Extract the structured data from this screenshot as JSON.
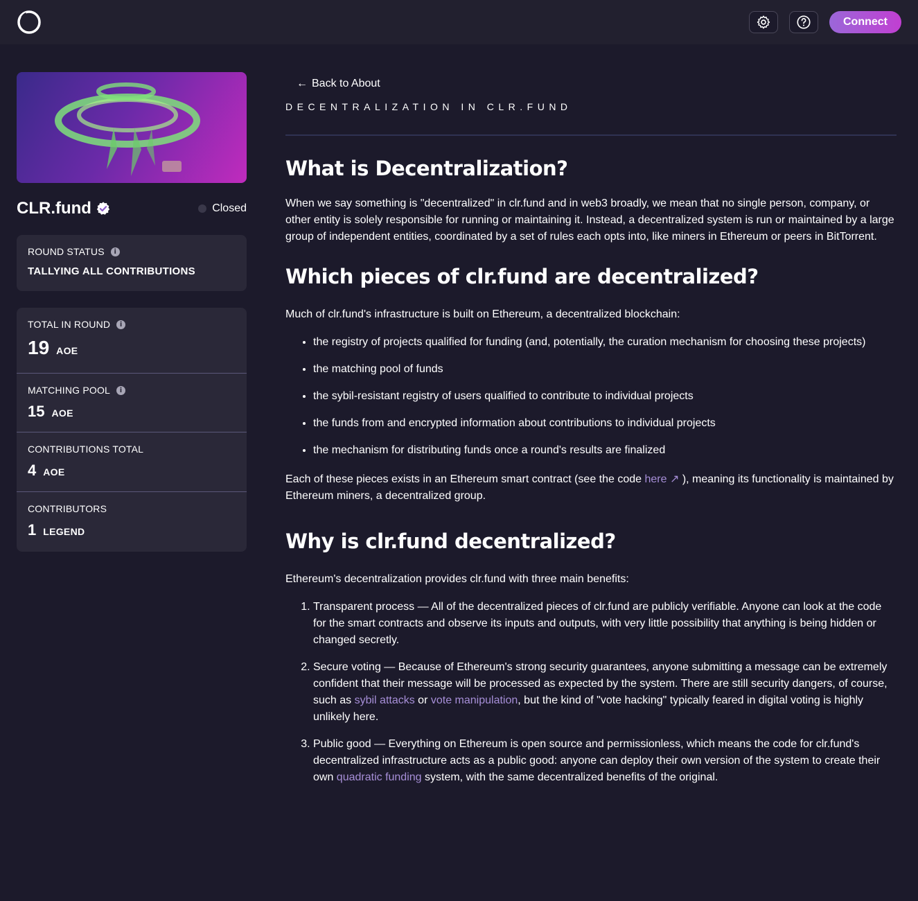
{
  "header": {
    "logo_icon": "clr-fund-ring-logo",
    "settings_icon": "gear-icon",
    "help_icon": "question-circle-icon",
    "connect_label": "Connect",
    "accent_gradient": [
      "#9b67d8",
      "#c13fd2"
    ]
  },
  "sidebar": {
    "project_name": "CLR.fund",
    "verified_icon": "verified-badge-icon",
    "status_label": "Closed",
    "round_status": {
      "label": "ROUND STATUS",
      "value": "TALLYING ALL CONTRIBUTIONS"
    },
    "stats": {
      "total": {
        "label": "TOTAL IN ROUND",
        "value": "19",
        "unit": "AOE"
      },
      "matching": {
        "label": "MATCHING POOL",
        "value": "15",
        "unit": "AOE"
      },
      "contributions": {
        "label": "CONTRIBUTIONS TOTAL",
        "value": "4",
        "unit": "AOE"
      },
      "contributors": {
        "label": "CONTRIBUTORS",
        "value": "1",
        "unit": "LEGEND"
      }
    },
    "info_glyph": "i"
  },
  "main": {
    "back_label": "Back to About",
    "back_arrow": "←",
    "section_label": "DECENTRALIZATION IN CLR.FUND",
    "h1": "What is Decentralization?",
    "p1": "When we say something is \"decentralized\" in clr.fund and in web3 broadly, we mean that no single person, company, or other entity is solely responsible for running or maintaining it. Instead, a decentralized system is run or maintained by a large group of independent entities, coordinated by a set of rules each opts into, like miners in Ethereum or peers in BitTorrent.",
    "h2": "Which pieces of clr.fund are decentralized?",
    "p2": "Much of clr.fund's infrastructure is built on Ethereum, a decentralized blockchain:",
    "bullets": [
      "the registry of projects qualified for funding (and, potentially, the curation mechanism for choosing these projects)",
      "the matching pool of funds",
      "the sybil-resistant registry of users qualified to contribute to individual projects",
      "the funds from and encrypted information about contributions to individual projects",
      "the mechanism for distributing funds once a round's results are finalized"
    ],
    "p3_before": "Each of these pieces exists in an Ethereum smart contract (see the code ",
    "p3_link": "here",
    "p3_link_icon": "↗",
    "p3_after": " ), meaning its functionality is maintained by Ethereum miners, a decentralized group.",
    "h3": "Why is clr.fund decentralized?",
    "p4": "Ethereum's decentralization provides clr.fund with three main benefits:",
    "benefits": {
      "one": "Transparent process — All of the decentralized pieces of clr.fund are publicly verifiable. Anyone can look at the code for the smart contracts and observe its inputs and outputs, with very little possibility that anything is being hidden or changed secretly.",
      "two_a": "Secure voting — Because of Ethereum's strong security guarantees, anyone submitting a message can be extremely confident that their message will be processed as expected by the system. There are still security dangers, of course, such as ",
      "two_link1": "sybil attacks",
      "two_b": " or ",
      "two_link2": "vote manipulation",
      "two_c": ", but the kind of \"vote hacking\" typically feared in digital voting is highly unlikely here.",
      "three_a": "Public good — Everything on Ethereum is open source and permissionless, which means the code for clr.fund's decentralized infrastructure acts as a public good: anyone can deploy their own version of the system to create their own ",
      "three_link": "quadratic funding",
      "three_b": " system, with the same decentralized benefits of the original."
    },
    "link_color": "#a78fd8"
  }
}
